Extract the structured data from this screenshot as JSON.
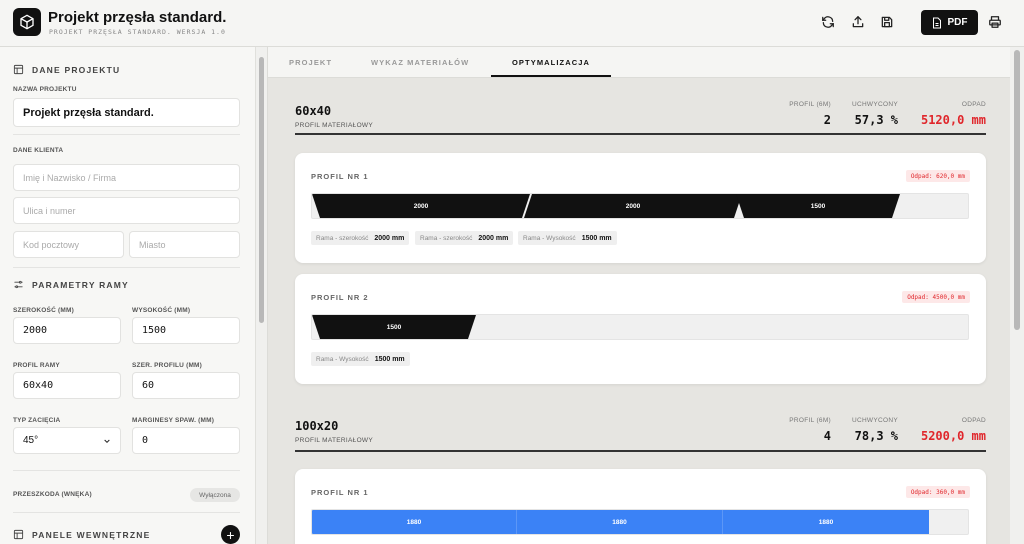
{
  "header": {
    "title": "Projekt przęsła standard.",
    "subtitle": "PROJEKT PRZĘSŁA STANDARD. WERSJA 1.0",
    "pdf_label": "PDF"
  },
  "sidebar": {
    "project_section": "DANE PROJEKTU",
    "project_name_label": "NAZWA PROJEKTU",
    "project_name_value": "Projekt przęsła standard.",
    "client_label": "DANE KLIENTA",
    "client_name_placeholder": "Imię i Nazwisko / Firma",
    "street_placeholder": "Ulica i numer",
    "postal_placeholder": "Kod pocztowy",
    "city_placeholder": "Miasto",
    "frame_section": "PARAMETRY RAMY",
    "width_label": "SZEROKOŚĆ (MM)",
    "width_value": "2000",
    "height_label": "WYSOKOŚĆ (MM)",
    "height_value": "1500",
    "profile_label": "PROFIL RAMY",
    "profile_value": "60x40",
    "profile_width_label": "SZER. PROFILU (MM)",
    "profile_width_value": "60",
    "cut_label": "TYP ZACIĘCIA",
    "cut_value": "45°",
    "weld_label": "MARGINESY SPAW. (MM)",
    "weld_value": "0",
    "obstacle_label": "PRZESZKODA (WNĘKA)",
    "obstacle_badge": "Wyłączona",
    "panels_section": "PANELE WEWNĘTRZNE"
  },
  "tabs": [
    "PROJEKT",
    "WYKAZ MATERIAŁÓW",
    "OPTYMALIZACJA"
  ],
  "stat_labels": {
    "count": "PROFIL (6M)",
    "used": "UCHWYCONY",
    "waste": "ODPAD"
  },
  "groups": [
    {
      "name": "60x40",
      "sub": "PROFIL MATERIAŁOWY",
      "count": "2",
      "used": "57,3 %",
      "waste": "5120,0 mm",
      "cards": [
        {
          "title": "PROFIL NR 1",
          "waste": "Odpad: 620,0 mm",
          "segments": [
            "2000",
            "2000",
            "1500"
          ],
          "chips": [
            {
              "label": "Rama - szerokość",
              "value": "2000 mm"
            },
            {
              "label": "Rama - szerokość",
              "value": "2000 mm"
            },
            {
              "label": "Rama - Wysokość",
              "value": "1500 mm"
            }
          ]
        },
        {
          "title": "PROFIL NR 2",
          "waste": "Odpad: 4500,0 mm",
          "segments": [
            "1500"
          ],
          "chips": [
            {
              "label": "Rama - Wysokość",
              "value": "1500 mm"
            }
          ]
        }
      ]
    },
    {
      "name": "100x20",
      "sub": "PROFIL MATERIAŁOWY",
      "count": "4",
      "used": "78,3 %",
      "waste": "5200,0 mm",
      "cards": [
        {
          "title": "PROFIL NR 1",
          "waste": "Odpad: 360,0 mm",
          "segments": [
            "1880",
            "1880",
            "1880"
          ]
        }
      ]
    }
  ],
  "colors": {
    "accent": "#111111",
    "waste_red": "#e0262b",
    "segment_blue": "#3b82f6"
  }
}
